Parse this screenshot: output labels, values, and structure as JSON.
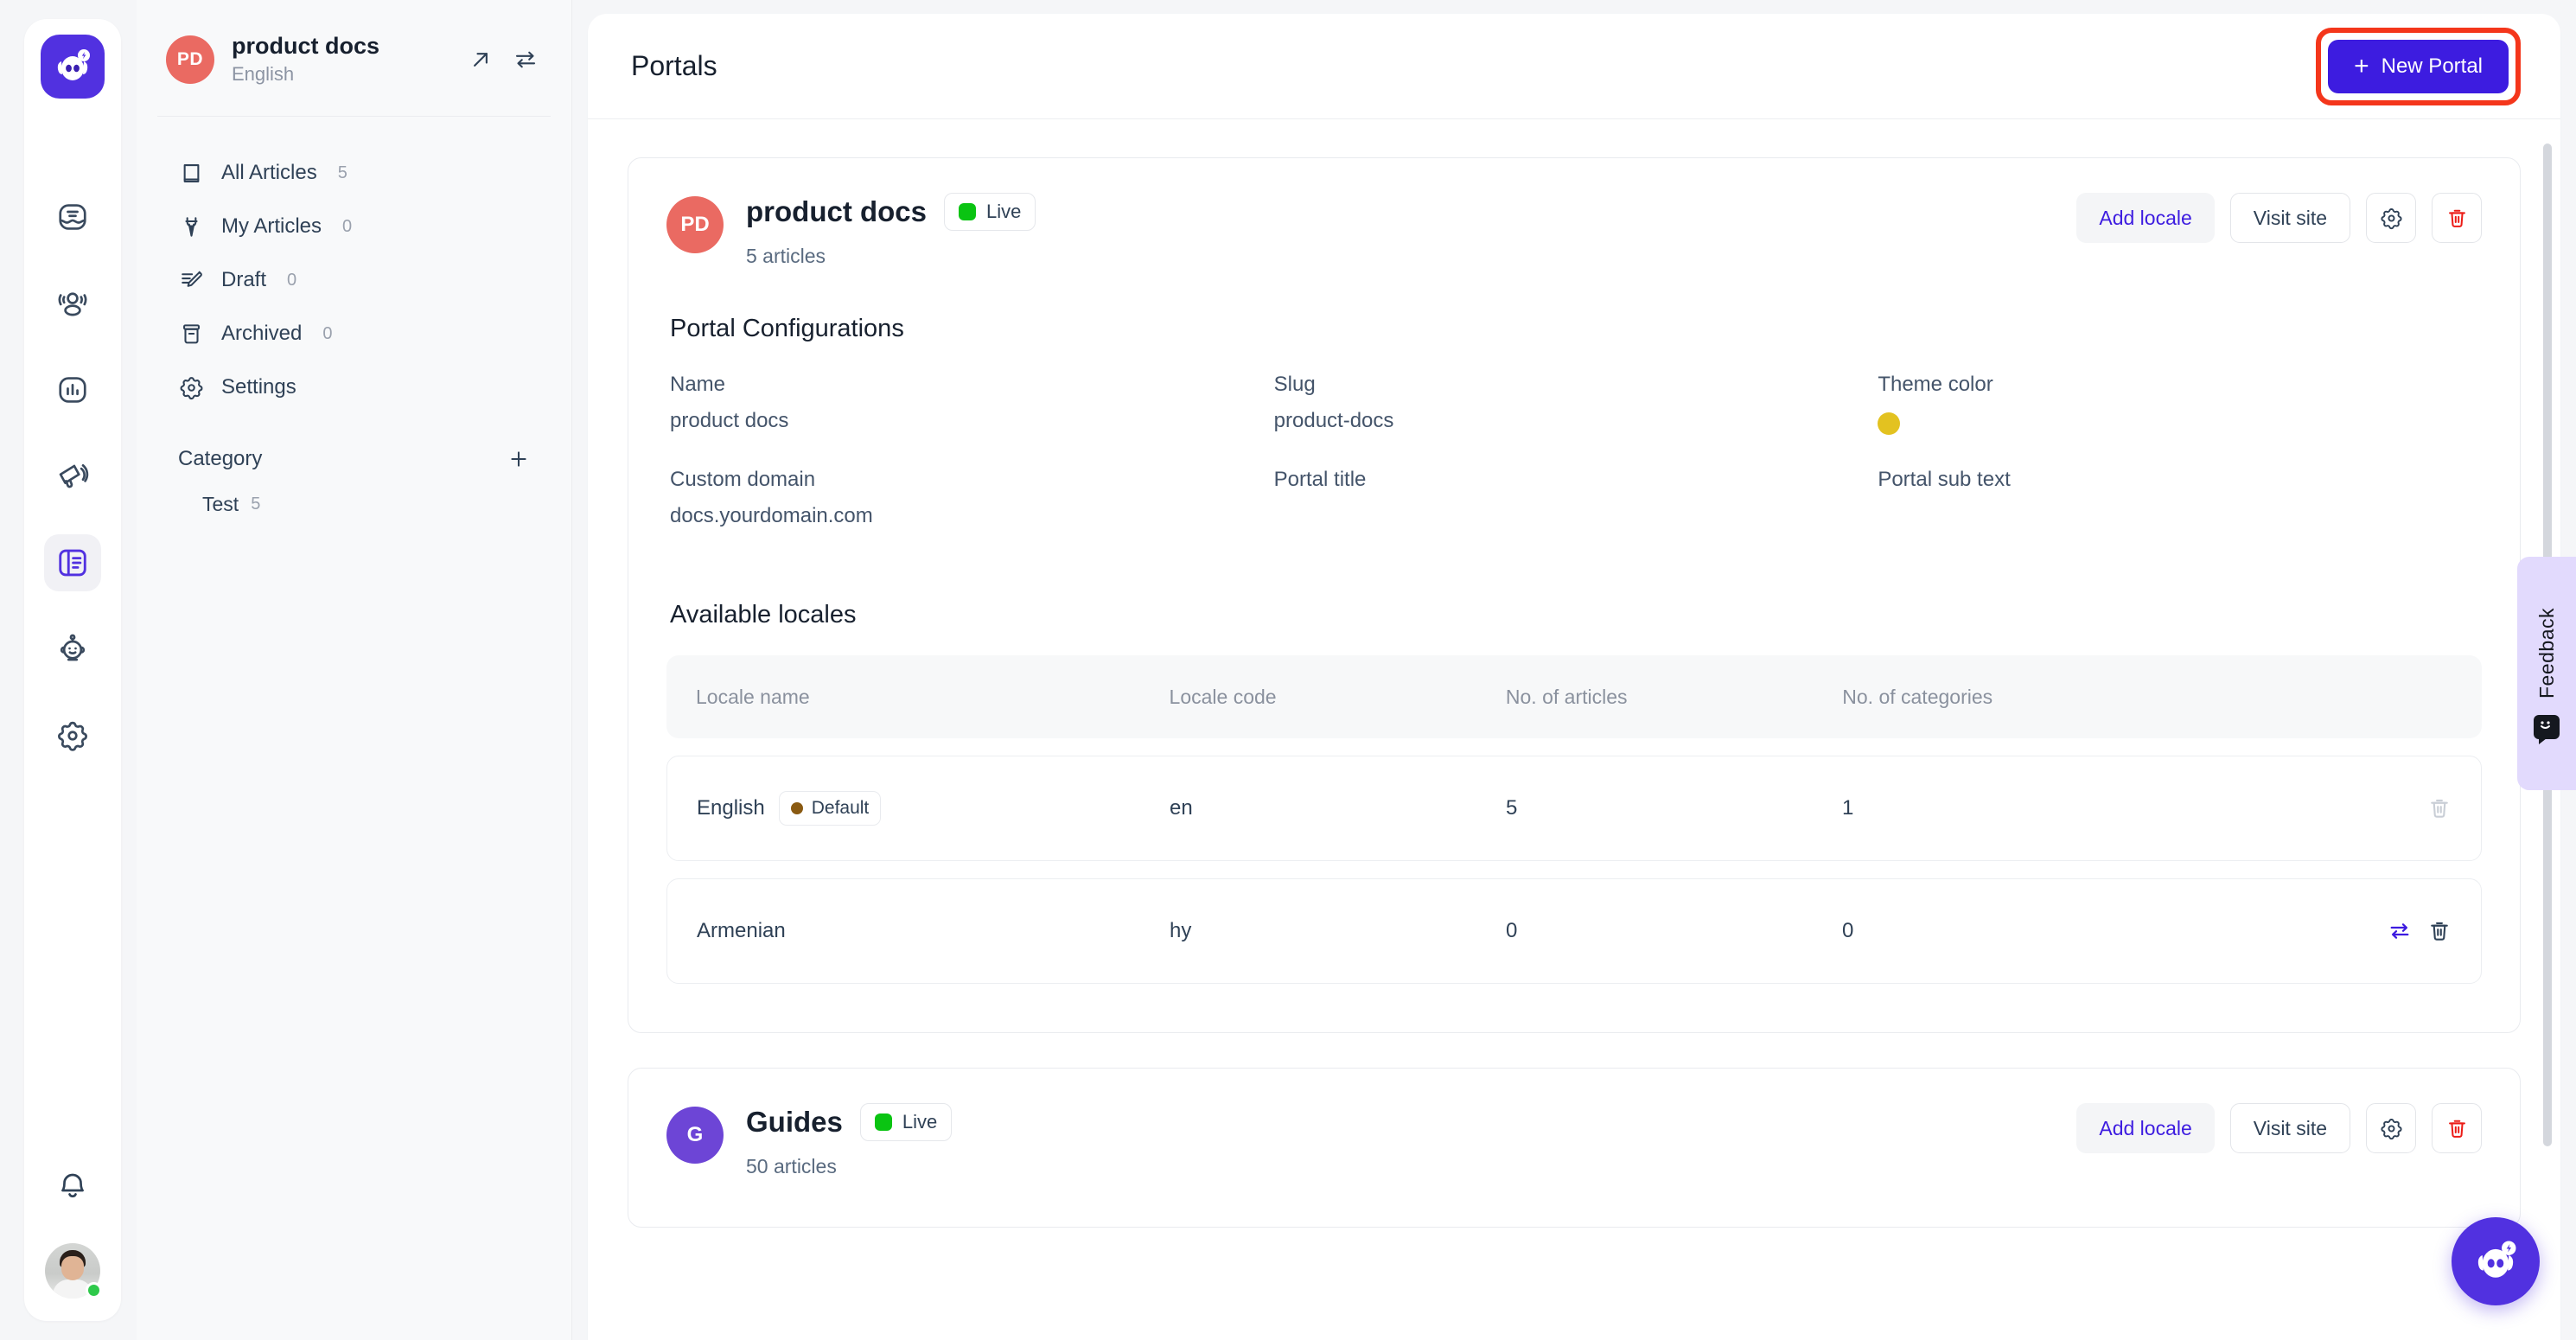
{
  "brand": {
    "logo_name": "chatwoot-logo",
    "accent": "#5131e0",
    "primary": "#3d1ce0"
  },
  "rail": {
    "items": [
      {
        "name": "conversations",
        "icon": "inbox-icon"
      },
      {
        "name": "contacts",
        "icon": "contacts-icon"
      },
      {
        "name": "reports",
        "icon": "bar-chart-icon"
      },
      {
        "name": "campaigns",
        "icon": "megaphone-icon"
      },
      {
        "name": "knowledge-base",
        "icon": "portal-icon",
        "active": true
      },
      {
        "name": "captain-ai",
        "icon": "robot-icon"
      },
      {
        "name": "settings",
        "icon": "gear-icon"
      }
    ],
    "bottom": [
      {
        "name": "notifications",
        "icon": "bell-icon"
      },
      {
        "name": "profile",
        "icon": "avatar",
        "status": "online"
      }
    ]
  },
  "sidebar": {
    "portal": {
      "initials": "PD",
      "name": "product docs",
      "locale": "English"
    },
    "portal_actions": [
      {
        "name": "open-portal",
        "icon": "arrow-up-right-icon"
      },
      {
        "name": "switch-portal",
        "icon": "swap-icon"
      }
    ],
    "nav": [
      {
        "label": "All Articles",
        "count": "5",
        "icon": "book-icon"
      },
      {
        "label": "My Articles",
        "count": "0",
        "icon": "pen-nib-icon"
      },
      {
        "label": "Draft",
        "count": "0",
        "icon": "draft-pencil-icon"
      },
      {
        "label": "Archived",
        "count": "0",
        "icon": "archive-icon"
      },
      {
        "label": "Settings",
        "count": "",
        "icon": "gear-icon"
      }
    ],
    "category": {
      "title": "Category",
      "add_label": "+",
      "items": [
        {
          "label": "Test",
          "count": "5"
        }
      ]
    }
  },
  "header": {
    "title": "Portals",
    "new_portal_label": "New Portal",
    "new_portal_plus": "+",
    "highlighted": true,
    "highlight_color": "#f4361b"
  },
  "portals": [
    {
      "initials": "PD",
      "avatar_color": "#ea6a62",
      "name": "product docs",
      "status": "Live",
      "articles": "5 articles",
      "actions": {
        "add_locale": "Add locale",
        "visit_site": "Visit site",
        "settings_icon": "gear-icon",
        "delete_icon": "trash-icon"
      },
      "configurations": {
        "title": "Portal Configurations",
        "fields": [
          {
            "label": "Name",
            "value": "product docs"
          },
          {
            "label": "Slug",
            "value": "product-docs"
          },
          {
            "label": "Theme color",
            "value": "",
            "swatch": "#e3c220"
          },
          {
            "label": "Custom domain",
            "value": "docs.yourdomain.com"
          },
          {
            "label": "Portal title",
            "value": ""
          },
          {
            "label": "Portal sub text",
            "value": ""
          }
        ]
      },
      "locales": {
        "title": "Available locales",
        "columns": [
          "Locale name",
          "Locale code",
          "No. of articles",
          "No. of categories",
          ""
        ],
        "rows": [
          {
            "locale_name": "English",
            "default_badge": "Default",
            "locale_code": "en",
            "articles": "5",
            "categories": "1",
            "can_swap": false,
            "delete_enabled": false
          },
          {
            "locale_name": "Armenian",
            "default_badge": "",
            "locale_code": "hy",
            "articles": "0",
            "categories": "0",
            "can_swap": true,
            "delete_enabled": true
          }
        ]
      }
    },
    {
      "initials": "G",
      "avatar_color": "#6d45d6",
      "name": "Guides",
      "status": "Live",
      "articles": "50 articles",
      "actions": {
        "add_locale": "Add locale",
        "visit_site": "Visit site",
        "settings_icon": "gear-icon",
        "delete_icon": "trash-icon"
      }
    }
  ],
  "feedback": {
    "label": "Feedback",
    "icon": "smiley-chat-icon"
  },
  "fab": {
    "name": "chat-bubble-fab",
    "icon": "chat-bot-icon"
  }
}
